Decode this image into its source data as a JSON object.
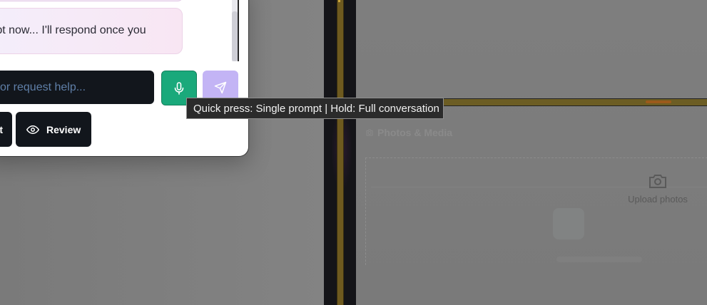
{
  "chat": {
    "message_fragment": "mpt now... I'll respond once you",
    "input_placeholder": "or request help...",
    "input_value": "",
    "mic_icon": "microphone-icon",
    "send_icon": "send-icon",
    "partial_button_label": "t",
    "review_button_label": "Review",
    "review_icon": "eye-icon"
  },
  "tooltip": {
    "text": "Quick press: Single prompt | Hold: Full conversation"
  },
  "photos": {
    "section_title": "Photos & Media",
    "section_icon": "camera-icon",
    "upload_label": "Upload photos",
    "upload_icon": "camera-icon"
  },
  "colors": {
    "mic_button": "#1aa97b",
    "send_button": "#c3b4f5",
    "dark_button": "#12161c",
    "overlay": "#7c7c7c"
  }
}
